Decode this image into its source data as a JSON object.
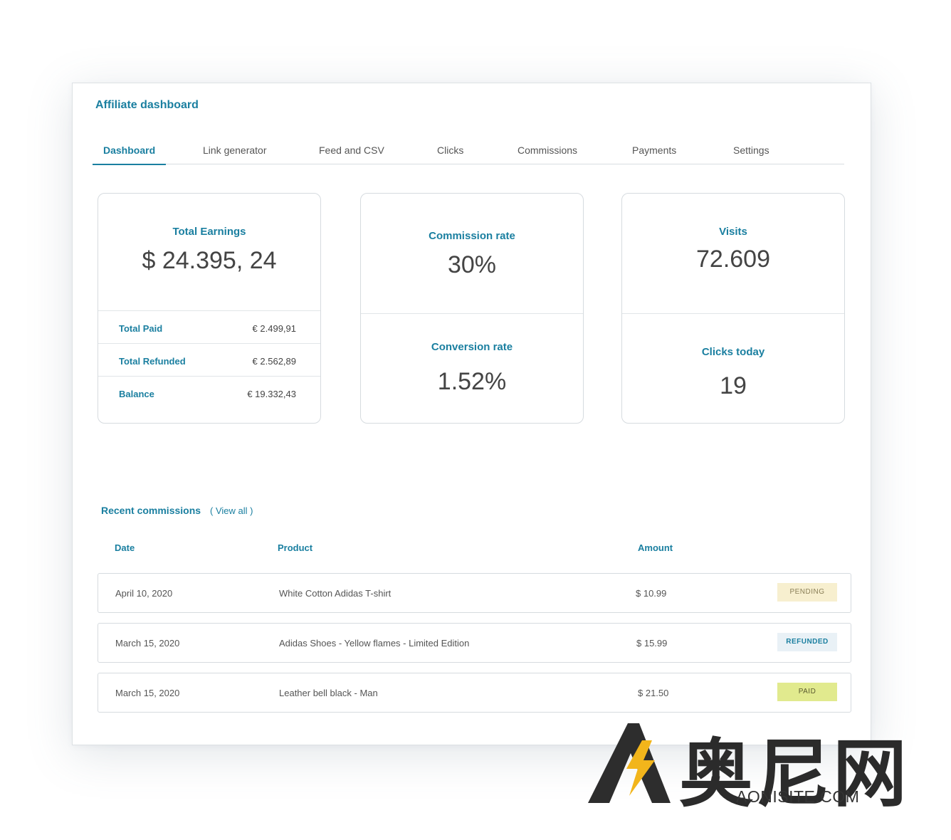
{
  "header": {
    "title": "Affiliate dashboard"
  },
  "tabs": [
    {
      "label": "Dashboard",
      "active": true
    },
    {
      "label": "Link generator"
    },
    {
      "label": "Feed and CSV"
    },
    {
      "label": "Clicks"
    },
    {
      "label": "Commissions"
    },
    {
      "label": "Payments"
    },
    {
      "label": "Settings"
    }
  ],
  "earnings": {
    "label": "Total Earnings",
    "value": "$ 24.395, 24",
    "rows": [
      {
        "label": "Total Paid",
        "value": "€ 2.499,91"
      },
      {
        "label": "Total Refunded",
        "value": "€ 2.562,89"
      },
      {
        "label": "Balance",
        "value": "€ 19.332,43"
      }
    ]
  },
  "rates": {
    "commission_label": "Commission rate",
    "commission_value": "30%",
    "conversion_label": "Conversion rate",
    "conversion_value": "1.52%"
  },
  "traffic": {
    "visits_label": "Visits",
    "visits_value": "72.609",
    "clicks_label": "Clicks today",
    "clicks_value": "19"
  },
  "recent": {
    "title": "Recent commissions",
    "view_all": "( View all )",
    "columns": {
      "date": "Date",
      "product": "Product",
      "amount": "Amount"
    },
    "rows": [
      {
        "date": "April 10, 2020",
        "product": "White Cotton Adidas T-shirt",
        "amount": "$ 10.99",
        "status": "PENDING"
      },
      {
        "date": "March 15, 2020",
        "product": "Adidas Shoes - Yellow flames - Limited Edition",
        "amount": "$ 15.99",
        "status": "REFUNDED"
      },
      {
        "date": "March 15, 2020",
        "product": "Leather bell black - Man",
        "amount": "$ 21.50",
        "status": "PAID"
      }
    ]
  },
  "watermark": {
    "chars": "奥尼网",
    "url": "AONISITE.COM"
  },
  "colors": {
    "accent": "#1a7fa0",
    "pending": "#f7efcf",
    "refunded": "#e9f1f6",
    "paid": "#e1ea8e"
  }
}
